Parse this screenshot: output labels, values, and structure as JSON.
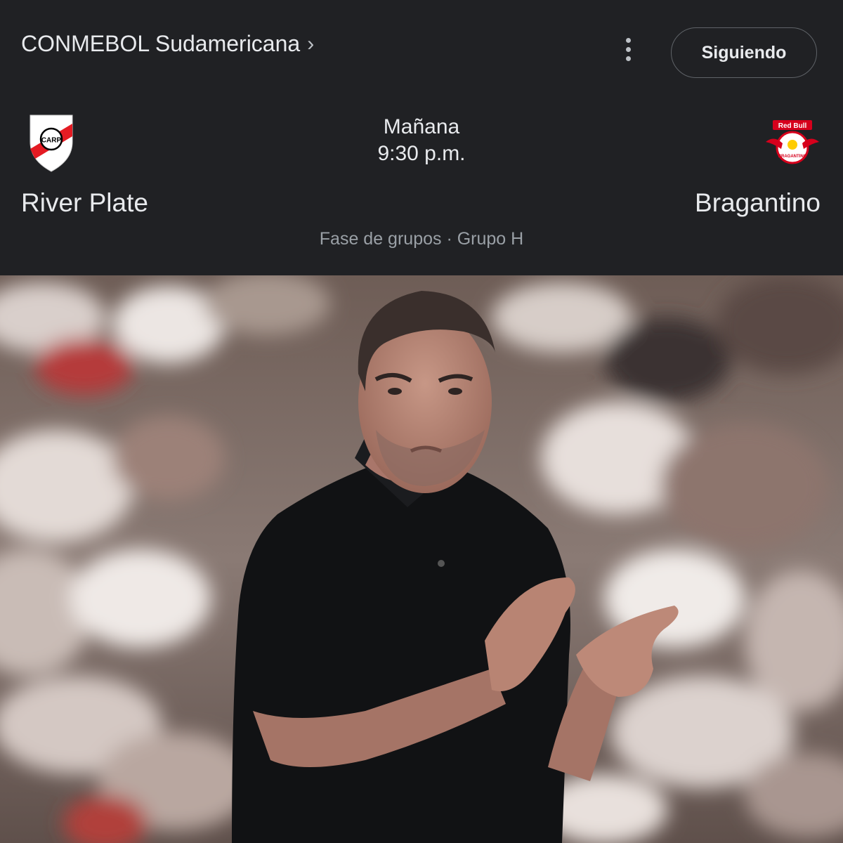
{
  "header": {
    "competition": "CONMEBOL Sudamericana",
    "competition_chevron": "›",
    "more_icon": "more-vert-icon",
    "follow_label": "Siguiendo"
  },
  "match": {
    "home": {
      "name": "River Plate",
      "crest_letters": "CARP",
      "crest_colors": [
        "#ffffff",
        "#e41b23",
        "#000000"
      ]
    },
    "away": {
      "name": "Bragantino",
      "crest_brand": "Red Bull",
      "crest_text": "BRAGANTINO",
      "crest_colors": [
        "#ffffff",
        "#d6001c",
        "#ffcc00"
      ]
    },
    "day": "Mañana",
    "time": "9:30 p.m.",
    "stage": "Fase de grupos · Grupo H"
  },
  "colors": {
    "background": "#202124",
    "text_primary": "#e8eaed",
    "text_secondary": "#9aa0a6",
    "button_border": "#5f6368"
  }
}
